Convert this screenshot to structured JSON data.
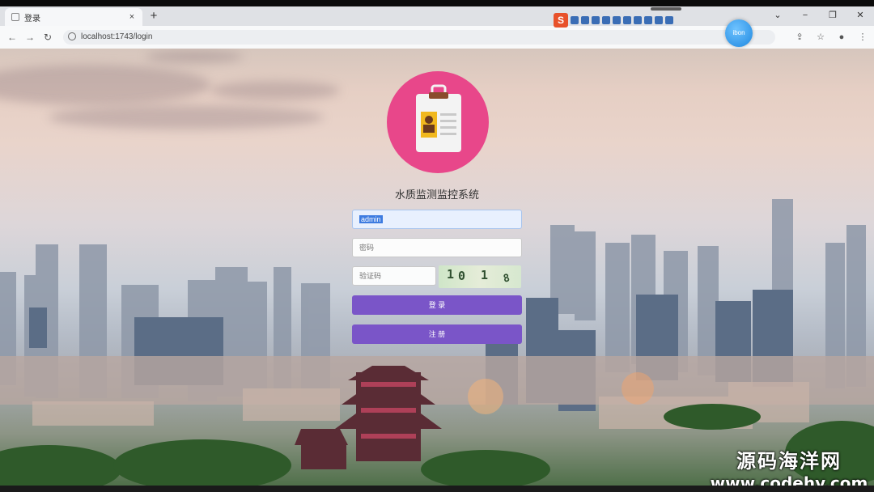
{
  "browser": {
    "tab_title": "登录",
    "new_tab_symbol": "+",
    "close_symbol": "×",
    "url": "localhost:1743/login",
    "window_controls": [
      "⌄",
      "−",
      "❐",
      "✕"
    ],
    "back": "←",
    "forward": "→",
    "reload": "↻",
    "float_bubble_text": "ibon"
  },
  "ime": {
    "logo": "S"
  },
  "login": {
    "app_title": "水质监测监控系统",
    "username_value": "admin",
    "password_placeholder": "密码",
    "captcha_placeholder": "验证码",
    "captcha_chars": [
      "1",
      "0",
      "1",
      "8"
    ],
    "login_button": "登 录",
    "register_button": "注 册",
    "avatar_color": "#e8478a",
    "button_color": "#7a55c8"
  },
  "watermark": {
    "cn": "源码海洋网",
    "en": "www.codehy.com"
  }
}
